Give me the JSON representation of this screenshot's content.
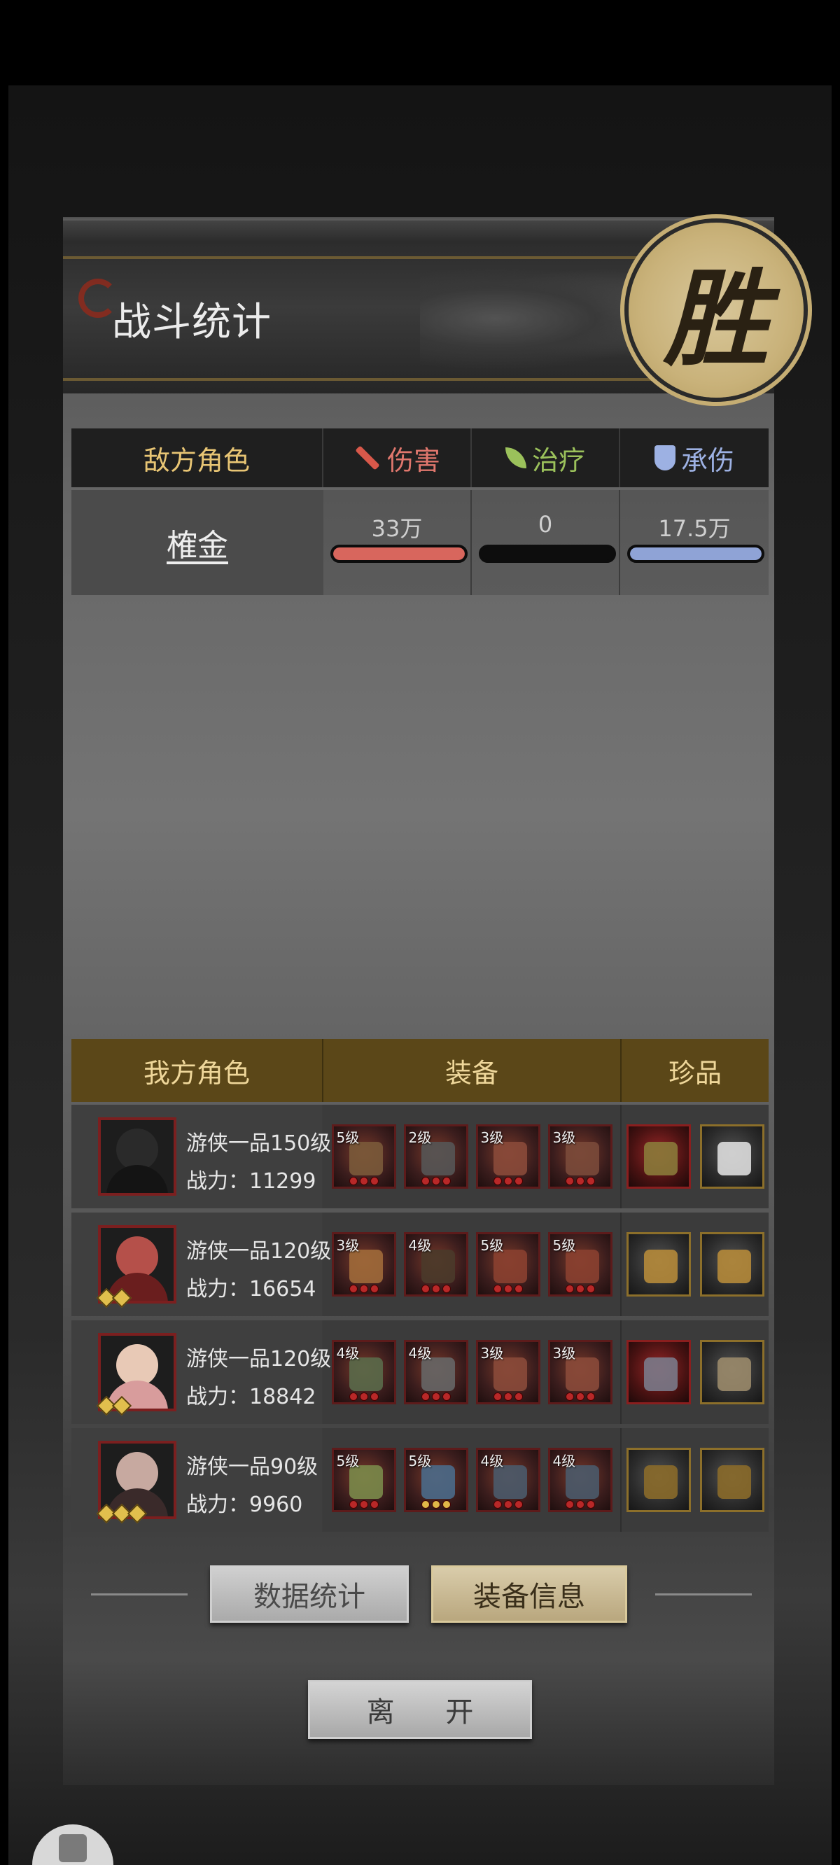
{
  "header": {
    "title": "战斗统计",
    "result_seal": "胜"
  },
  "enemy_table": {
    "headers": {
      "role": "敌方角色",
      "damage": "伤害",
      "heal": "治疗",
      "tank": "承伤"
    },
    "rows": [
      {
        "name": "榷金",
        "damage": "33万",
        "heal": "0",
        "tank": "17.5万",
        "damage_fill": 1.0,
        "heal_fill": 0.0,
        "tank_fill": 1.0
      }
    ]
  },
  "ally_table": {
    "headers": {
      "role": "我方角色",
      "equipment": "装备",
      "treasure": "珍品"
    },
    "power_label": "战力：",
    "rows": [
      {
        "class": "游侠一品150级",
        "power": "11299",
        "stars": 0,
        "equip_levels": [
          "5级",
          "2级",
          "3级",
          "3级"
        ]
      },
      {
        "class": "游侠一品120级",
        "power": "16654",
        "stars": 2,
        "equip_levels": [
          "3级",
          "4级",
          "5级",
          "5级"
        ]
      },
      {
        "class": "游侠一品120级",
        "power": "18842",
        "stars": 2,
        "equip_levels": [
          "4级",
          "4级",
          "3级",
          "3级"
        ]
      },
      {
        "class": "游侠一品90级",
        "power": "9960",
        "stars": 3,
        "equip_levels": [
          "5级",
          "5级",
          "4级",
          "4级"
        ]
      }
    ]
  },
  "buttons": {
    "stats": "数据统计",
    "equip_info": "装备信息",
    "leave": "离 开"
  },
  "colors": {
    "damage": "#d8665d",
    "heal": "#9bc15b",
    "tank": "#8fa3d6",
    "gold": "#e8c574"
  }
}
